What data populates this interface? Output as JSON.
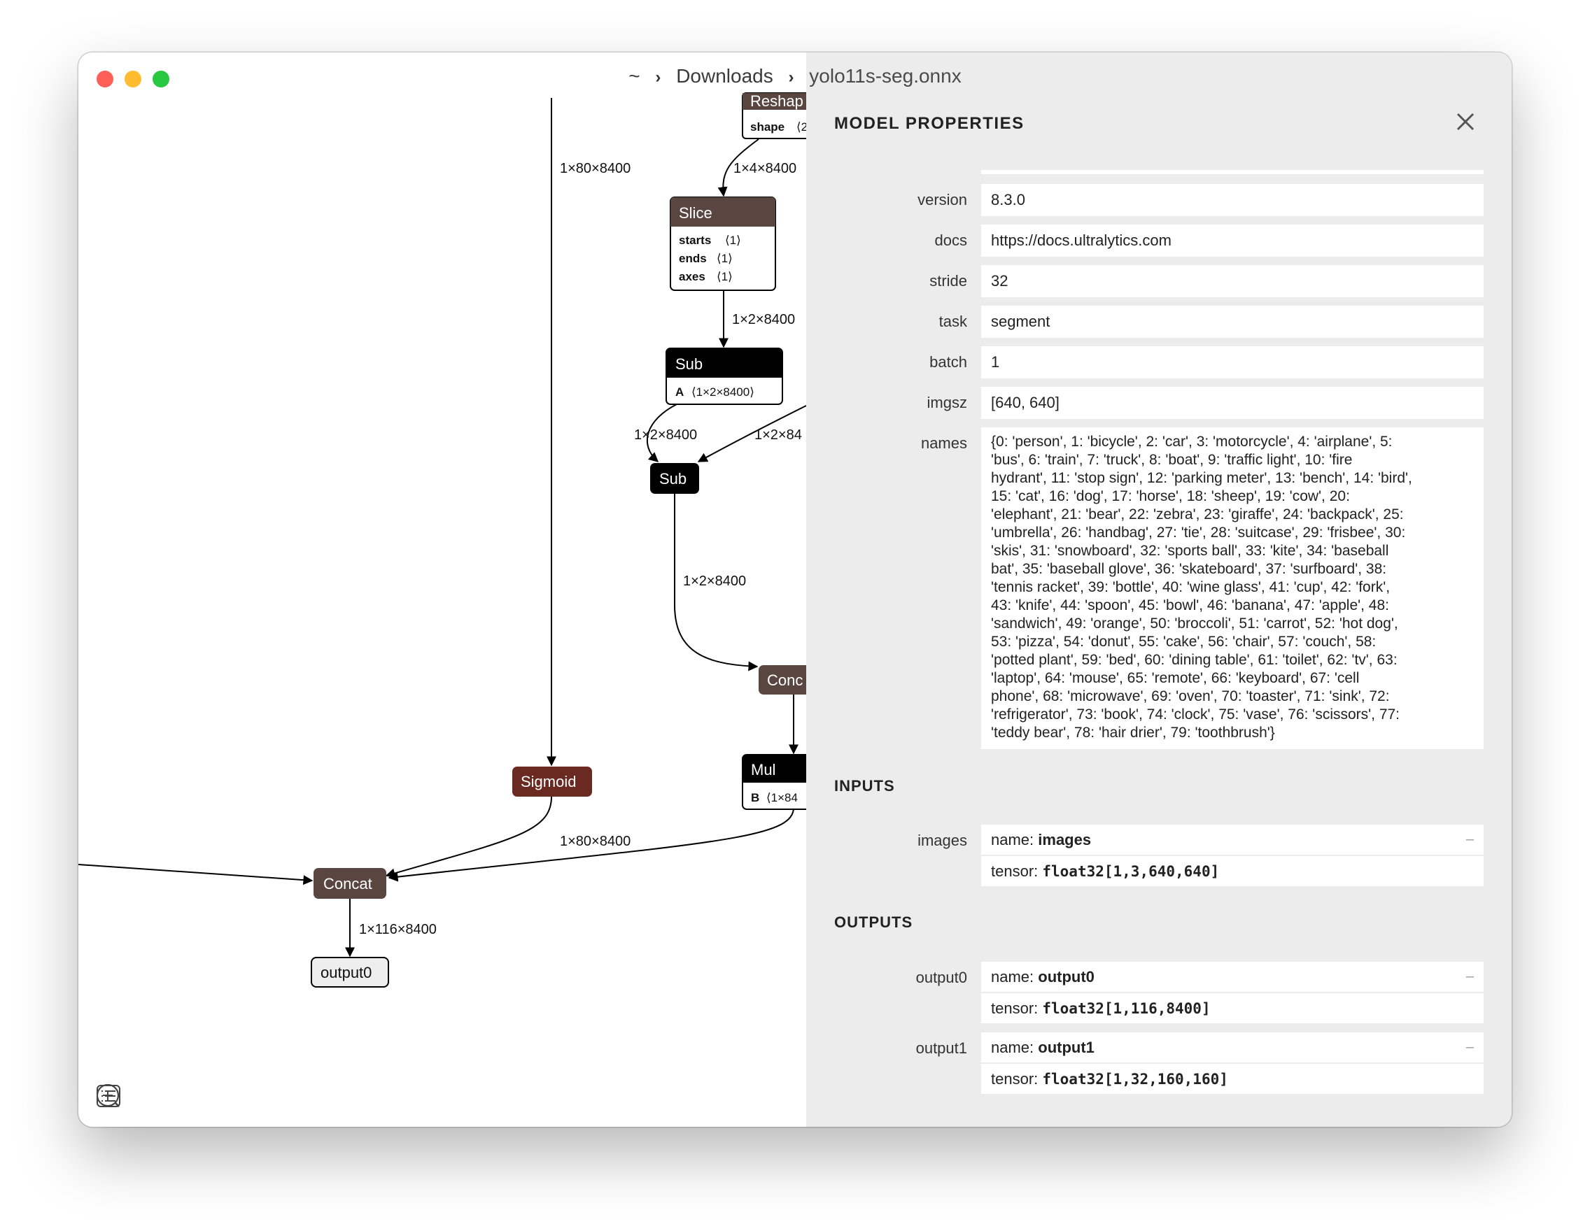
{
  "breadcrumb": [
    "~",
    "Downloads",
    "yolo11s-seg.onnx"
  ],
  "graph": {
    "edges": {
      "e_80x8400_top": "1×80×8400",
      "e_4x8400": "1×4×8400",
      "e_2x8400_a": "1×2×8400",
      "e_2x8400_b": "1×2×8400",
      "e_2x84_c": "1×2×84",
      "e_2x8400_d": "1×2×8400",
      "e_80x8400_bottom": "1×80×8400",
      "e_116x8400": "1×116×8400"
    },
    "nodes": {
      "reshape": {
        "title": "Reshap",
        "attr_name": "shape",
        "attr_val": "⟨2"
      },
      "slice": {
        "title": "Slice",
        "attrs": [
          {
            "name": "starts",
            "val": "⟨1⟩"
          },
          {
            "name": "ends",
            "val": "⟨1⟩"
          },
          {
            "name": "axes",
            "val": "⟨1⟩"
          }
        ]
      },
      "sub1": {
        "title": "Sub",
        "attr_name": "A",
        "attr_val": "⟨1×2×8400⟩"
      },
      "sub2": {
        "title": "Sub"
      },
      "conc": {
        "title": "Conc"
      },
      "mul": {
        "title": "Mul",
        "attr_name": "B",
        "attr_val": "⟨1×84"
      },
      "sigmoid": {
        "title": "Sigmoid"
      },
      "concat": {
        "title": "Concat"
      },
      "output0": {
        "title": "output0"
      }
    },
    "colors": {
      "layer": "#5a4640",
      "activation": "#6a2a22",
      "math": "#000000",
      "edge": "#000000"
    }
  },
  "toolbar": {
    "icons": [
      "list-icon",
      "zoom-in-icon",
      "zoom-out-icon"
    ]
  },
  "panel": {
    "title": "MODEL PROPERTIES",
    "properties": [
      {
        "label": "version",
        "value": "8.3.0"
      },
      {
        "label": "docs",
        "value": "https://docs.ultralytics.com"
      },
      {
        "label": "stride",
        "value": "32"
      },
      {
        "label": "task",
        "value": "segment"
      },
      {
        "label": "batch",
        "value": "1"
      },
      {
        "label": "imgsz",
        "value": "[640, 640]"
      }
    ],
    "names": {
      "label": "names",
      "lines": [
        "{0: 'person', 1: 'bicycle', 2: 'car', 3: 'motorcycle', 4: 'airplane', 5:",
        "'bus', 6: 'train', 7: 'truck', 8: 'boat', 9: 'traffic light', 10: 'fire",
        "hydrant', 11: 'stop sign', 12: 'parking meter', 13: 'bench', 14: 'bird',",
        "15: 'cat', 16: 'dog', 17: 'horse', 18: 'sheep', 19: 'cow', 20:",
        "'elephant', 21: 'bear', 22: 'zebra', 23: 'giraffe', 24: 'backpack', 25:",
        "'umbrella', 26: 'handbag', 27: 'tie', 28: 'suitcase', 29: 'frisbee', 30:",
        "'skis', 31: 'snowboard', 32: 'sports ball', 33: 'kite', 34: 'baseball",
        "bat', 35: 'baseball glove', 36: 'skateboard', 37: 'surfboard', 38:",
        "'tennis racket', 39: 'bottle', 40: 'wine glass', 41: 'cup', 42: 'fork',",
        "43: 'knife', 44: 'spoon', 45: 'bowl', 46: 'banana', 47: 'apple', 48:",
        "'sandwich', 49: 'orange', 50: 'broccoli', 51: 'carrot', 52: 'hot dog',",
        "53: 'pizza', 54: 'donut', 55: 'cake', 56: 'chair', 57: 'couch', 58:",
        "'potted plant', 59: 'bed', 60: 'dining table', 61: 'toilet', 62: 'tv', 63:",
        "'laptop', 64: 'mouse', 65: 'remote', 66: 'keyboard', 67: 'cell",
        "phone', 68: 'microwave', 69: 'oven', 70: 'toaster', 71: 'sink', 72:",
        "'refrigerator', 73: 'book', 74: 'clock', 75: 'vase', 76: 'scissors', 77:",
        "'teddy bear', 78: 'hair drier', 79: 'toothbrush'}"
      ]
    },
    "inputs_title": "INPUTS",
    "inputs": [
      {
        "label": "images",
        "name_prefix": "name: ",
        "name": "images",
        "tensor_prefix": "tensor: ",
        "tensor": "float32[1,3,640,640]",
        "toggle": "–"
      }
    ],
    "outputs_title": "OUTPUTS",
    "outputs": [
      {
        "label": "output0",
        "name_prefix": "name: ",
        "name": "output0",
        "tensor_prefix": "tensor: ",
        "tensor": "float32[1,116,8400]",
        "toggle": "–"
      },
      {
        "label": "output1",
        "name_prefix": "name: ",
        "name": "output1",
        "tensor_prefix": "tensor: ",
        "tensor": "float32[1,32,160,160]",
        "toggle": "–"
      }
    ]
  }
}
